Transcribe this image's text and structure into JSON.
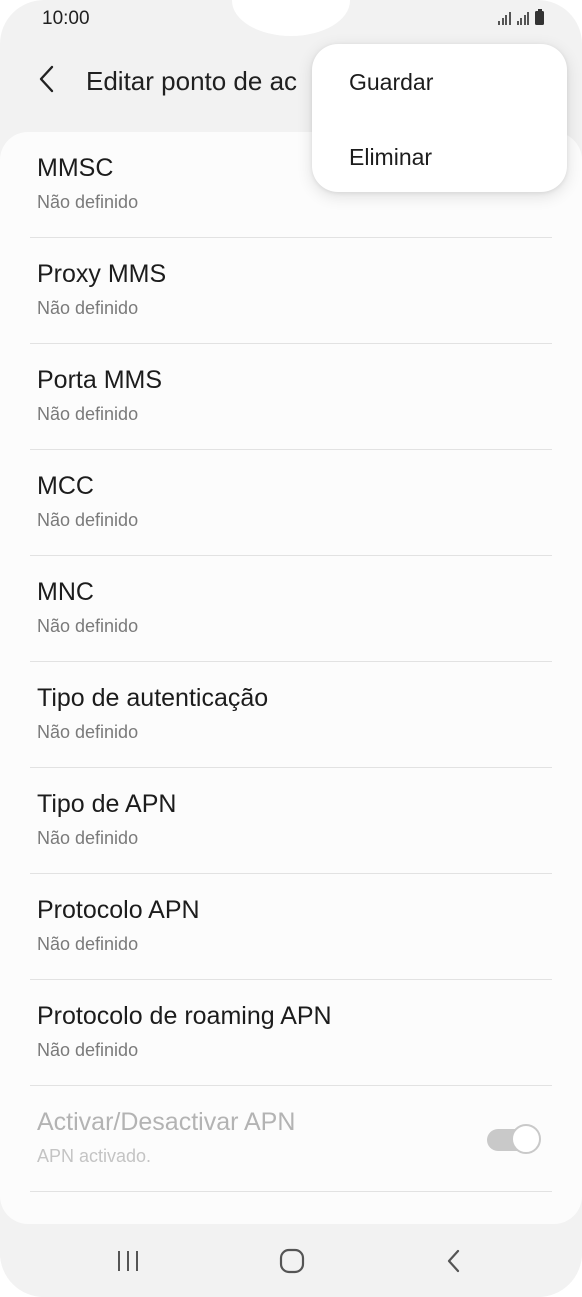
{
  "status_bar": {
    "time": "10:00"
  },
  "header": {
    "title": "Editar ponto de ac"
  },
  "menu": {
    "items": [
      "Guardar",
      "Eliminar"
    ]
  },
  "settings": {
    "items": [
      {
        "title": "MMSC",
        "value": "Não definido"
      },
      {
        "title": "Proxy MMS",
        "value": "Não definido"
      },
      {
        "title": "Porta MMS",
        "value": "Não definido"
      },
      {
        "title": "MCC",
        "value": "Não definido"
      },
      {
        "title": "MNC",
        "value": "Não definido"
      },
      {
        "title": "Tipo de autenticação",
        "value": "Não definido"
      },
      {
        "title": "Tipo de APN",
        "value": "Não definido"
      },
      {
        "title": "Protocolo APN",
        "value": "Não definido"
      },
      {
        "title": "Protocolo de roaming APN",
        "value": "Não definido"
      }
    ],
    "toggle_item": {
      "title": "Activar/Desactivar APN",
      "value": "APN activado.",
      "enabled": false,
      "checked": true
    }
  },
  "icons": {
    "back": "chevron-left-icon",
    "recents": "recent-apps-icon",
    "home": "home-icon",
    "nav_back": "back-icon"
  },
  "colors": {
    "background": "#f2f2f2",
    "card": "#fcfcfc",
    "text_primary": "#1c1c1c",
    "text_secondary": "#7a7a7a",
    "disabled": "#b3b3b3"
  }
}
